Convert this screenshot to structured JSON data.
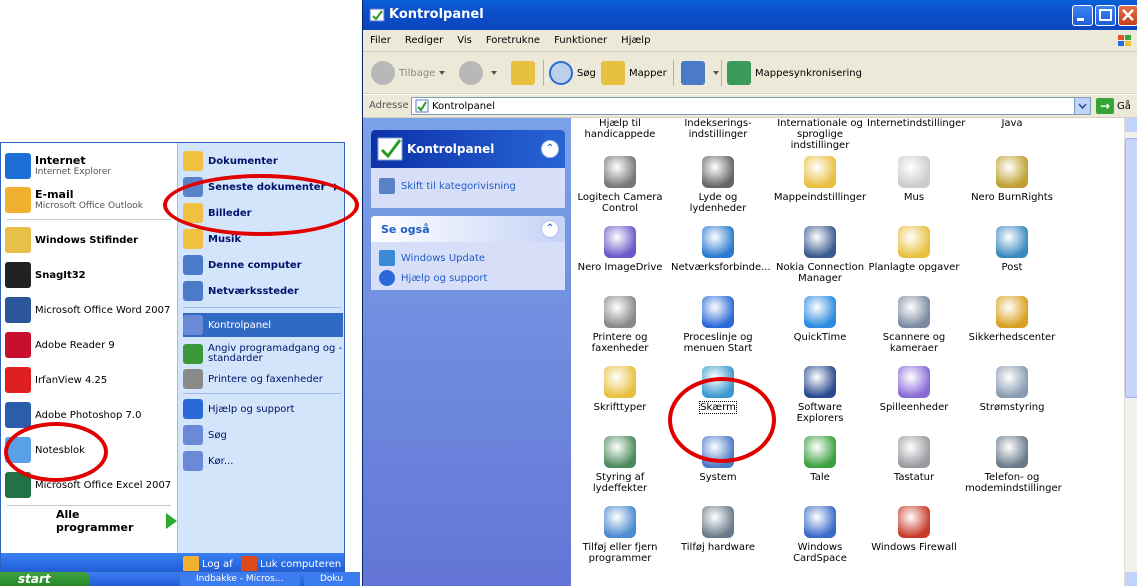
{
  "start_menu": {
    "pinned": [
      {
        "title": "Internet",
        "subtitle": "Internet Explorer",
        "color": "#1d6fd6"
      },
      {
        "title": "E-mail",
        "subtitle": "Microsoft Office Outlook",
        "color": "#f0b030"
      }
    ],
    "recent": [
      {
        "label": "Windows Stifinder",
        "bold": true,
        "color": "#e7c04c"
      },
      {
        "label": "SnagIt32",
        "bold": true,
        "color": "#222222"
      },
      {
        "label": "Microsoft Office Word 2007",
        "bold": false,
        "color": "#2b579a"
      },
      {
        "label": "Adobe Reader 9",
        "bold": false,
        "color": "#c8102e"
      },
      {
        "label": "IrfanView 4.25",
        "bold": false,
        "color": "#e02020"
      },
      {
        "label": "Adobe Photoshop 7.0",
        "bold": false,
        "color": "#2a5ea8"
      },
      {
        "label": "Notesblok",
        "bold": false,
        "color": "#5aa0e8"
      },
      {
        "label": "Microsoft Office Excel 2007",
        "bold": false,
        "color": "#217346"
      }
    ],
    "all_programs": "Alle programmer",
    "right": [
      {
        "label": "Dokumenter",
        "bold": true,
        "color": "#f0c040"
      },
      {
        "label": "Seneste dokumenter",
        "bold": true,
        "color": "#5a82c8",
        "arrow": true
      },
      {
        "label": "Billeder",
        "bold": true,
        "color": "#f0c040"
      },
      {
        "label": "Musik",
        "bold": true,
        "color": "#f0c040"
      },
      {
        "label": "Denne computer",
        "bold": true,
        "color": "#4a7ac8"
      },
      {
        "label": "Netværkssteder",
        "bold": true,
        "color": "#4a7ac8"
      },
      {
        "label": "Kontrolpanel",
        "bold": false,
        "color": "#6a8ad8",
        "selected": true
      },
      {
        "label": "Angiv programadgang og -standarder",
        "bold": false,
        "color": "#3a9a3a"
      },
      {
        "label": "Printere og faxenheder",
        "bold": false,
        "color": "#8a8a8a"
      },
      {
        "label": "Hjælp og support",
        "bold": false,
        "color": "#2a6ad8"
      },
      {
        "label": "Søg",
        "bold": false,
        "color": "#6a8ad8"
      },
      {
        "label": "Kør...",
        "bold": false,
        "color": "#6a8ad8"
      }
    ],
    "logoff": "Log af",
    "shutdown": "Luk computeren"
  },
  "taskbar": {
    "start": "start",
    "buttons": [
      "Indbakke - Micros...",
      "Doku"
    ]
  },
  "window": {
    "title": "Kontrolpanel",
    "menu": [
      "Filer",
      "Rediger",
      "Vis",
      "Foretrukne",
      "Funktioner",
      "Hjælp"
    ],
    "toolbar": {
      "back": "Tilbage",
      "search": "Søg",
      "folders": "Mapper",
      "sync": "Mappesynkronisering"
    },
    "address": {
      "label": "Adresse",
      "value": "Kontrolpanel",
      "go": "Gå"
    }
  },
  "taskpane": {
    "main_title": "Kontrolpanel",
    "switch_link": "Skift til kategorivisning",
    "see_also_title": "Se også",
    "see_also": [
      "Windows Update",
      "Hjælp og support"
    ]
  },
  "items": [
    {
      "label": "Hjælp til handicappede",
      "color": "#3a7ad8"
    },
    {
      "label": "Indekserings-indstillinger",
      "color": "#5a8ad0"
    },
    {
      "label": "Internationale og sproglige indstillinger",
      "color": "#3a8ac8"
    },
    {
      "label": "Internetindstillinger",
      "color": "#2a6ad8"
    },
    {
      "label": "Java",
      "color": "#d85a2a"
    },
    {
      "label": "Logitech Camera Control",
      "color": "#777777"
    },
    {
      "label": "Lyde og lydenheder",
      "color": "#666666"
    },
    {
      "label": "Mappeindstillinger",
      "color": "#e8c040"
    },
    {
      "label": "Mus",
      "color": "#cccccc"
    },
    {
      "label": "Nero BurnRights",
      "color": "#c0a030"
    },
    {
      "label": "Nero ImageDrive",
      "color": "#6a5ac8"
    },
    {
      "label": "Netværksforbinde...",
      "color": "#2a7ad0"
    },
    {
      "label": "Nokia Connection Manager",
      "color": "#3a5a90"
    },
    {
      "label": "Planlagte opgaver",
      "color": "#e8c040"
    },
    {
      "label": "Post",
      "color": "#3a8ac0"
    },
    {
      "label": "Printere og faxenheder",
      "color": "#888888"
    },
    {
      "label": "Proceslinje og menuen Start",
      "color": "#2a6ad8"
    },
    {
      "label": "QuickTime",
      "color": "#2a8ae0"
    },
    {
      "label": "Scannere og kameraer",
      "color": "#7a8aa0"
    },
    {
      "label": "Sikkerhedscenter",
      "color": "#d8a020"
    },
    {
      "label": "Skrifttyper",
      "color": "#e8c040"
    },
    {
      "label": "Skærm",
      "color": "#3a9ad0",
      "focus": true
    },
    {
      "label": "Software Explorers",
      "color": "#2a4a90"
    },
    {
      "label": "Spilleenheder",
      "color": "#8a6ad8"
    },
    {
      "label": "Strømstyring",
      "color": "#8a9ab0"
    },
    {
      "label": "Styring af lydeffekter",
      "color": "#4a8a5a"
    },
    {
      "label": "System",
      "color": "#4a7ac8"
    },
    {
      "label": "Tale",
      "color": "#3aa040"
    },
    {
      "label": "Tastatur",
      "color": "#9a9aa0"
    },
    {
      "label": "Telefon- og modemindstillinger",
      "color": "#6a7a8a"
    },
    {
      "label": "Tilføj eller fjern programmer",
      "color": "#4a8ad0"
    },
    {
      "label": "Tilføj hardware",
      "color": "#6a7a8a"
    },
    {
      "label": "Windows CardSpace",
      "color": "#3a6ac8"
    },
    {
      "label": "Windows Firewall",
      "color": "#c83a2a"
    }
  ]
}
